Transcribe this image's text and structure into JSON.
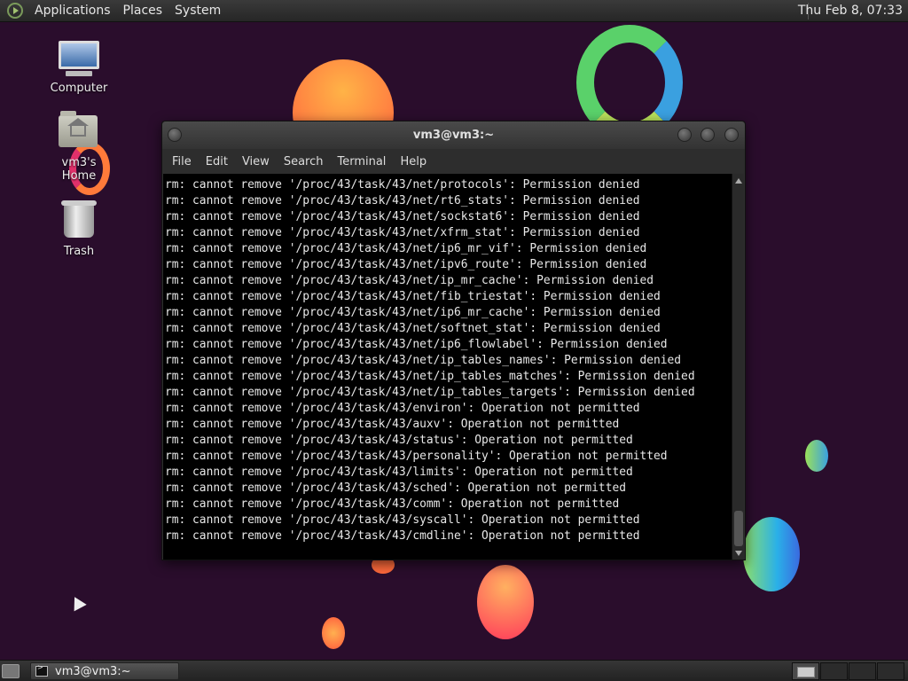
{
  "top_panel": {
    "menus": [
      "Applications",
      "Places",
      "System"
    ],
    "clock": "Thu Feb  8, 07:33"
  },
  "desktop_icons": [
    {
      "label": "Computer",
      "icon": "computer-icon"
    },
    {
      "label": "vm3's Home",
      "icon": "home-folder-icon"
    },
    {
      "label": "Trash",
      "icon": "trash-icon"
    }
  ],
  "window": {
    "title": "vm3@vm3:~",
    "menus": [
      "File",
      "Edit",
      "View",
      "Search",
      "Terminal",
      "Help"
    ],
    "lines": [
      "rm: cannot remove '/proc/43/task/43/net/protocols': Permission denied",
      "rm: cannot remove '/proc/43/task/43/net/rt6_stats': Permission denied",
      "rm: cannot remove '/proc/43/task/43/net/sockstat6': Permission denied",
      "rm: cannot remove '/proc/43/task/43/net/xfrm_stat': Permission denied",
      "rm: cannot remove '/proc/43/task/43/net/ip6_mr_vif': Permission denied",
      "rm: cannot remove '/proc/43/task/43/net/ipv6_route': Permission denied",
      "rm: cannot remove '/proc/43/task/43/net/ip_mr_cache': Permission denied",
      "rm: cannot remove '/proc/43/task/43/net/fib_triestat': Permission denied",
      "rm: cannot remove '/proc/43/task/43/net/ip6_mr_cache': Permission denied",
      "rm: cannot remove '/proc/43/task/43/net/softnet_stat': Permission denied",
      "rm: cannot remove '/proc/43/task/43/net/ip6_flowlabel': Permission denied",
      "rm: cannot remove '/proc/43/task/43/net/ip_tables_names': Permission denied",
      "rm: cannot remove '/proc/43/task/43/net/ip_tables_matches': Permission denied",
      "rm: cannot remove '/proc/43/task/43/net/ip_tables_targets': Permission denied",
      "rm: cannot remove '/proc/43/task/43/environ': Operation not permitted",
      "rm: cannot remove '/proc/43/task/43/auxv': Operation not permitted",
      "rm: cannot remove '/proc/43/task/43/status': Operation not permitted",
      "rm: cannot remove '/proc/43/task/43/personality': Operation not permitted",
      "rm: cannot remove '/proc/43/task/43/limits': Operation not permitted",
      "rm: cannot remove '/proc/43/task/43/sched': Operation not permitted",
      "rm: cannot remove '/proc/43/task/43/comm': Operation not permitted",
      "rm: cannot remove '/proc/43/task/43/syscall': Operation not permitted",
      "rm: cannot remove '/proc/43/task/43/cmdline': Operation not permitted"
    ]
  },
  "taskbar": {
    "task_label": "vm3@vm3:~"
  },
  "colors": {
    "desktop_bg": "#2a0d2c",
    "terminal_bg": "#000000",
    "terminal_fg": "#e8e8e8"
  }
}
